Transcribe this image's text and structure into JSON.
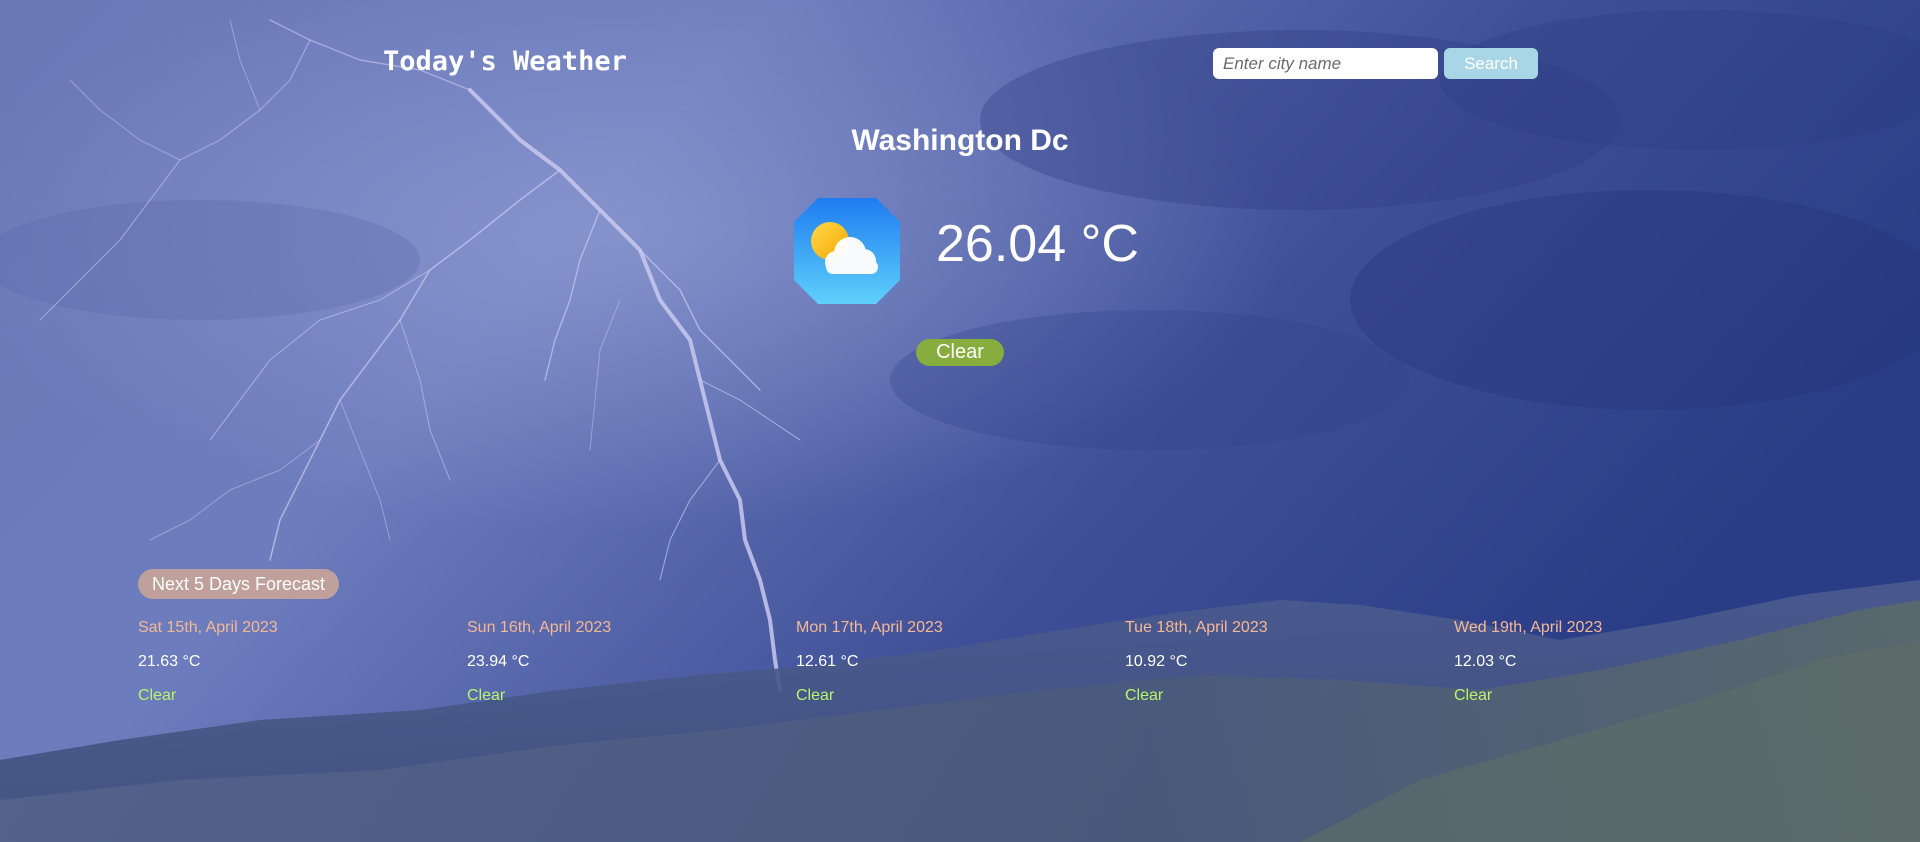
{
  "app": {
    "title": "Today's Weather"
  },
  "search": {
    "placeholder": "Enter city name",
    "value": "",
    "button_label": "Search"
  },
  "current": {
    "city": "Washington Dc",
    "temperature": "26.04 °C",
    "condition": "Clear",
    "icon": "partly-cloudy-icon"
  },
  "forecast": {
    "heading": "Next 5 Days Forecast",
    "days": [
      {
        "date": "Sat 15th, April 2023",
        "temp": "21.63 °C",
        "condition": "Clear"
      },
      {
        "date": "Sun 16th, April 2023",
        "temp": "23.94 °C",
        "condition": "Clear"
      },
      {
        "date": "Mon 17th, April 2023",
        "temp": "12.61 °C",
        "condition": "Clear"
      },
      {
        "date": "Tue 18th, April 2023",
        "temp": "10.92 °C",
        "condition": "Clear"
      },
      {
        "date": "Wed 19th, April 2023",
        "temp": "12.03 °C",
        "condition": "Clear"
      }
    ]
  },
  "colors": {
    "condition_badge": "#86ad3e",
    "forecast_heading_bg": "#bfa09a",
    "forecast_date": "#f4b896",
    "forecast_condition": "#b8f56c",
    "search_button": "#a9d6e6"
  }
}
